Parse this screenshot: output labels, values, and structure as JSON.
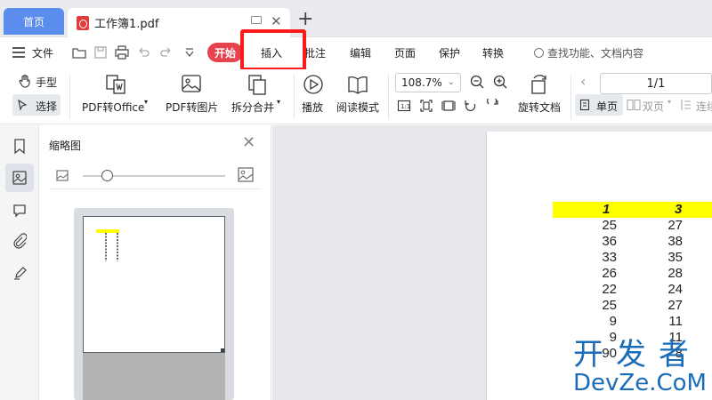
{
  "tabs": {
    "home_label": "首页",
    "doc_title": "工作簿1.pdf",
    "close_glyph": "✕",
    "new_tab_glyph": "+"
  },
  "menu": {
    "file_label": "文件",
    "items": [
      "开始",
      "插入",
      "批注",
      "编辑",
      "页面",
      "保护",
      "转换"
    ],
    "search_placeholder": "查找功能、文档内容",
    "active_item": "开始",
    "highlighted_item": "插入"
  },
  "ribbon": {
    "hand_label": "手型",
    "select_label": "选择",
    "pdf_to_office_label": "PDF转Office",
    "pdf_to_image_label": "PDF转图片",
    "split_merge_label": "拆分合并",
    "play_label": "播放",
    "read_mode_label": "阅读模式",
    "zoom_value": "108.7%",
    "rotate_doc_label": "旋转文档",
    "page_indicator": "1/1",
    "single_page_label": "单页",
    "double_page_label": "双页",
    "continuous_label": "连续"
  },
  "sidebar": {
    "panel_title": "缩略图",
    "close_glyph": "✕"
  },
  "document": {
    "header": [
      "1",
      "3"
    ],
    "col1": [
      "25",
      "36",
      "33",
      "26",
      "22",
      "25",
      "9",
      "9",
      "90"
    ],
    "col2": [
      "27",
      "38",
      "35",
      "28",
      "24",
      "27",
      "11",
      "11",
      "8"
    ]
  },
  "watermark": {
    "cn": "开发者",
    "en": "DevZe.CoM"
  },
  "colors": {
    "accent_blue": "#5b8def",
    "start_red": "#e6434f",
    "highlight_red": "#ff1a1a",
    "header_yellow": "#ffff00",
    "watermark_blue": "#1a6cb8"
  }
}
